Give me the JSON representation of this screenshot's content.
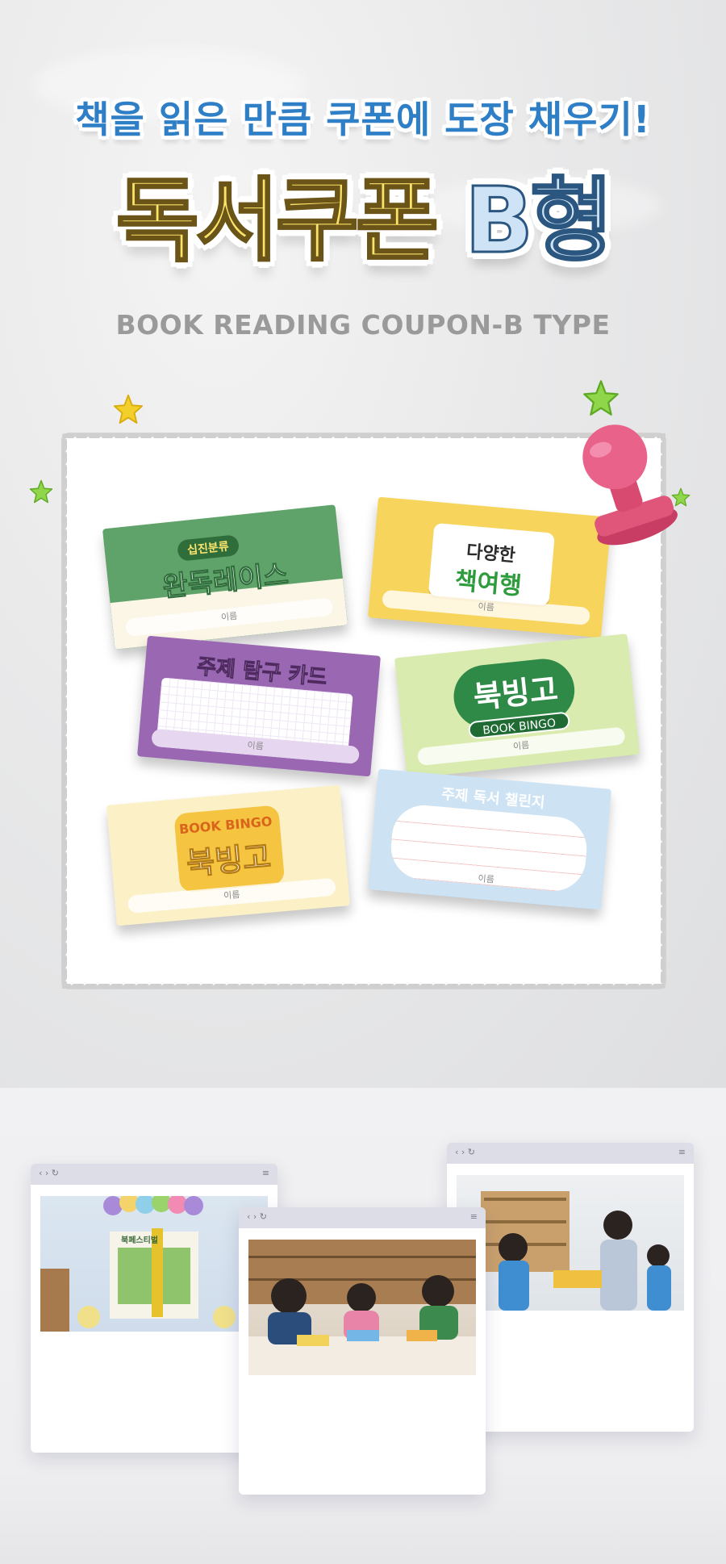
{
  "header": {
    "subtitle": "책을 읽은 만큼 쿠폰에 도장 채우기!",
    "title_main": "독서쿠폰",
    "title_type": "B형",
    "title_en": "BOOK READING COUPON-B TYPE"
  },
  "cards": {
    "card1": {
      "pill": "십진분류",
      "title": "완독레이스",
      "name": "이름"
    },
    "card2": {
      "title_top": "다양한",
      "title_bottom": "책여행",
      "name": "이름"
    },
    "card3": {
      "title": "주제 탐구 카드",
      "name": "이름"
    },
    "card4": {
      "title": "북빙고",
      "sub": "BOOK BINGO",
      "name": "이름"
    },
    "card5": {
      "sub": "BOOK BINGO",
      "title": "북빙고",
      "name": "이름"
    },
    "card6": {
      "title": "주제 독서 챌린지",
      "name": "이름"
    }
  },
  "windows": {
    "nav_glyph": "‹ › ↻",
    "menu_glyph": "≡",
    "w1_banner": "북페스티벌"
  },
  "colors": {
    "subtitle": "#2f7fc7",
    "title_main": "#fbe36a",
    "title_type": "#cfe3f6",
    "stamp": "#e0557a"
  }
}
